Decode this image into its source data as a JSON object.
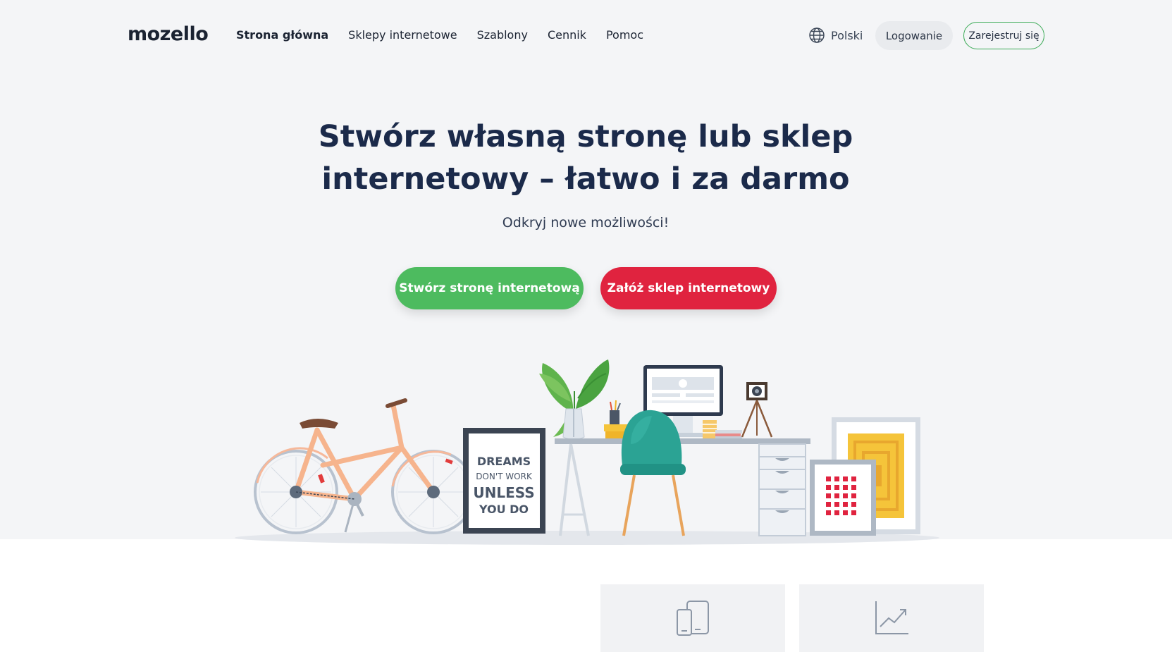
{
  "brand": {
    "logo": "mozello",
    "accent": "#4dbb5f",
    "shop_accent": "#e0233f"
  },
  "nav": {
    "links": [
      {
        "label": "Strona główna",
        "active": true
      },
      {
        "label": "Sklepy internetowe"
      },
      {
        "label": "Szablony"
      },
      {
        "label": "Cennik"
      },
      {
        "label": "Pomoc"
      }
    ],
    "language": "Polski",
    "login": "Logowanie",
    "register": "Zarejestruj się"
  },
  "hero": {
    "title_line1": "Stwórz własną stronę lub sklep",
    "title_line2": "internetowy – łatwo i za darmo",
    "subtitle": "Odkryj nowe możliwości!",
    "cta_site": "Stwórz stronę internetową",
    "cta_shop": "Załóż sklep internetowy"
  },
  "illustration": {
    "poster_lines": [
      "DREAMS",
      "DON'T WORK",
      "UNLESS",
      "YOU DO"
    ]
  },
  "features": [
    {
      "icon": "devices-icon"
    },
    {
      "icon": "growth-chart-icon"
    }
  ]
}
